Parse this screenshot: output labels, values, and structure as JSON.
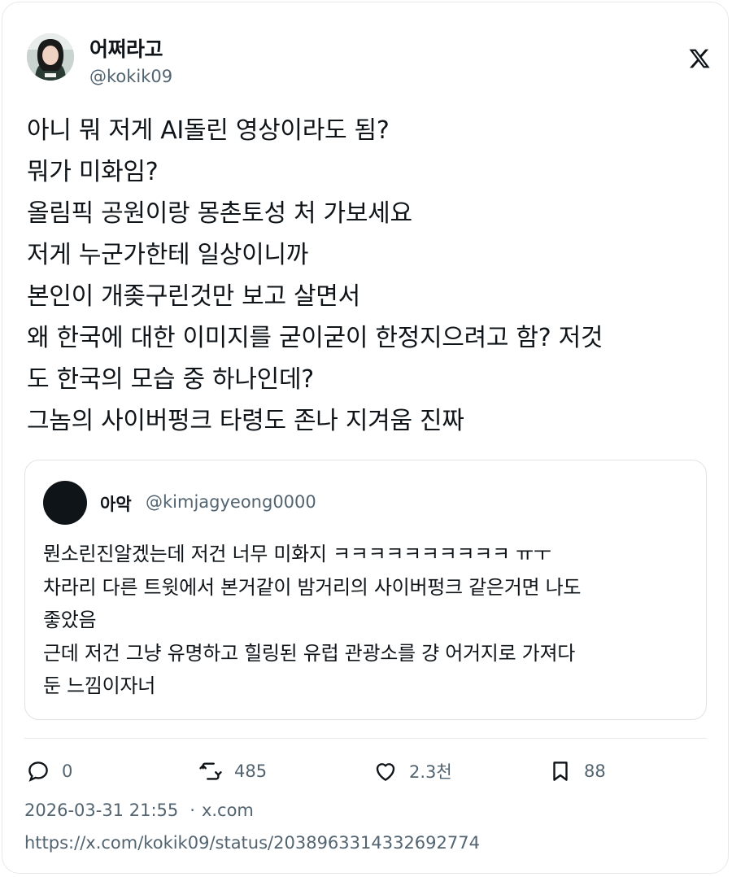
{
  "author": {
    "display_name": "어쩌라고",
    "handle": "@kokik09",
    "avatar_icon": "profile-photo"
  },
  "tweet_lines": [
    "아니 뭐 저게 AI돌린 영상이라도 됨?",
    "뭐가 미화임?",
    "올림픽 공원이랑 몽촌토성 처 가보세요",
    "저게 누군가한테 일상이니까",
    "본인이 개좆구린것만 보고 살면서",
    "왜 한국에 대한 이미지를 굳이굳이 한정지으려고 함? 저것",
    "도 한국의 모습 중 하나인데?",
    "그놈의 사이버펑크 타령도 존나 지겨움 진짜"
  ],
  "quoted": {
    "display_name": "아악",
    "handle": "@kimjagyeong0000",
    "lines": [
      "뭔소린진알겠는데 저건 너무 미화지 ㅋㅋㅋㅋㅋㅋㅋㅋㅋㅋ ㅠㅜ",
      "차라리 다른 트윗에서 본거같이 밤거리의 사이버펑크 같은거면 나도",
      "좋았음",
      "근데 저건 그냥 유명하고 힐링된 유럽 관광소를 걍 어거지로 가져다",
      "둔 느낌이자너"
    ]
  },
  "actions": {
    "replies": "0",
    "retweets": "485",
    "likes": "2.3천",
    "bookmarks": "88"
  },
  "meta": {
    "timestamp": "2026-03-31 21:55",
    "separator": "·",
    "source": "x.com",
    "url": "https://x.com/kokik09/status/2038963314332692774"
  },
  "colors": {
    "text": "#0f1419",
    "secondary": "#536471",
    "border": "#e6e9ec"
  }
}
